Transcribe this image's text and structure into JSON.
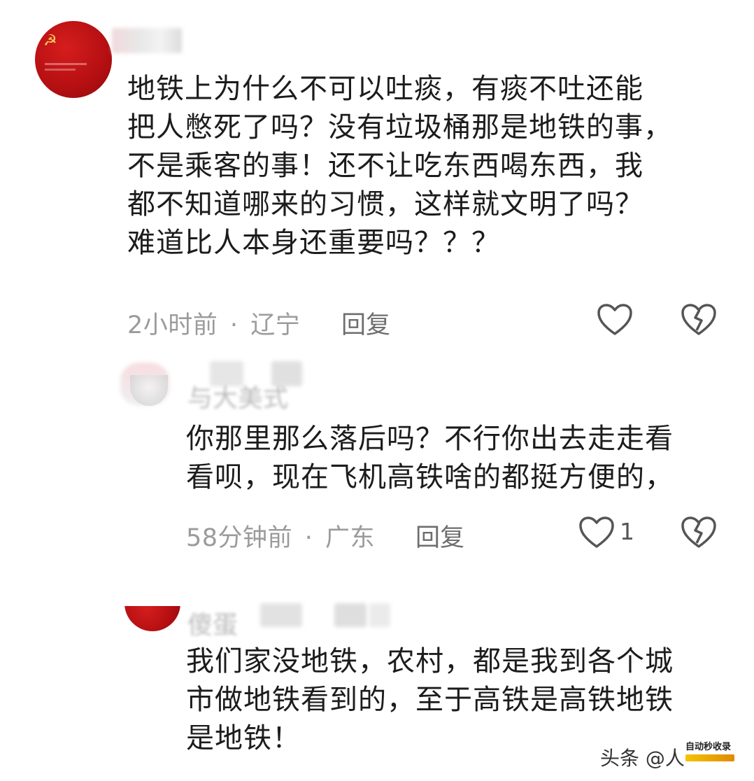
{
  "comments": [
    {
      "lines": [
        "地铁上为什么不可以吐痰，有痰不吐还能",
        "把人憋死了吗？没有垃圾桶那是地铁的事，",
        "不是乘客的事！还不让吃东西喝东西，我",
        "都不知道哪来的习惯，这样就文明了吗？",
        "难道比人本身还重要吗？？？"
      ],
      "time": "2小时前",
      "separator": "·",
      "location": "辽宁",
      "reply_label": "回复"
    },
    {
      "username_partial": "与大美式",
      "lines": [
        "你那里那么落后吗？不行你出去走走看",
        "看呗，现在飞机高铁啥的都挺方便的，"
      ],
      "time": "58分钟前",
      "separator": "·",
      "location": "广东",
      "reply_label": "回复",
      "like_count": "1"
    },
    {
      "username_partial": "傻蛋",
      "lines": [
        "我们家没地铁，农村，都是我到各个城",
        "市做地铁看到的，至于高铁是高铁地铁",
        "是地铁！"
      ]
    }
  ],
  "watermark": {
    "text": "头条 @人",
    "logo_text": "自动秒收录"
  },
  "colors": {
    "text": "#1c1c1c",
    "meta": "#9b9b9b",
    "icon": "#555555",
    "avatar_red": "#b40f12"
  }
}
